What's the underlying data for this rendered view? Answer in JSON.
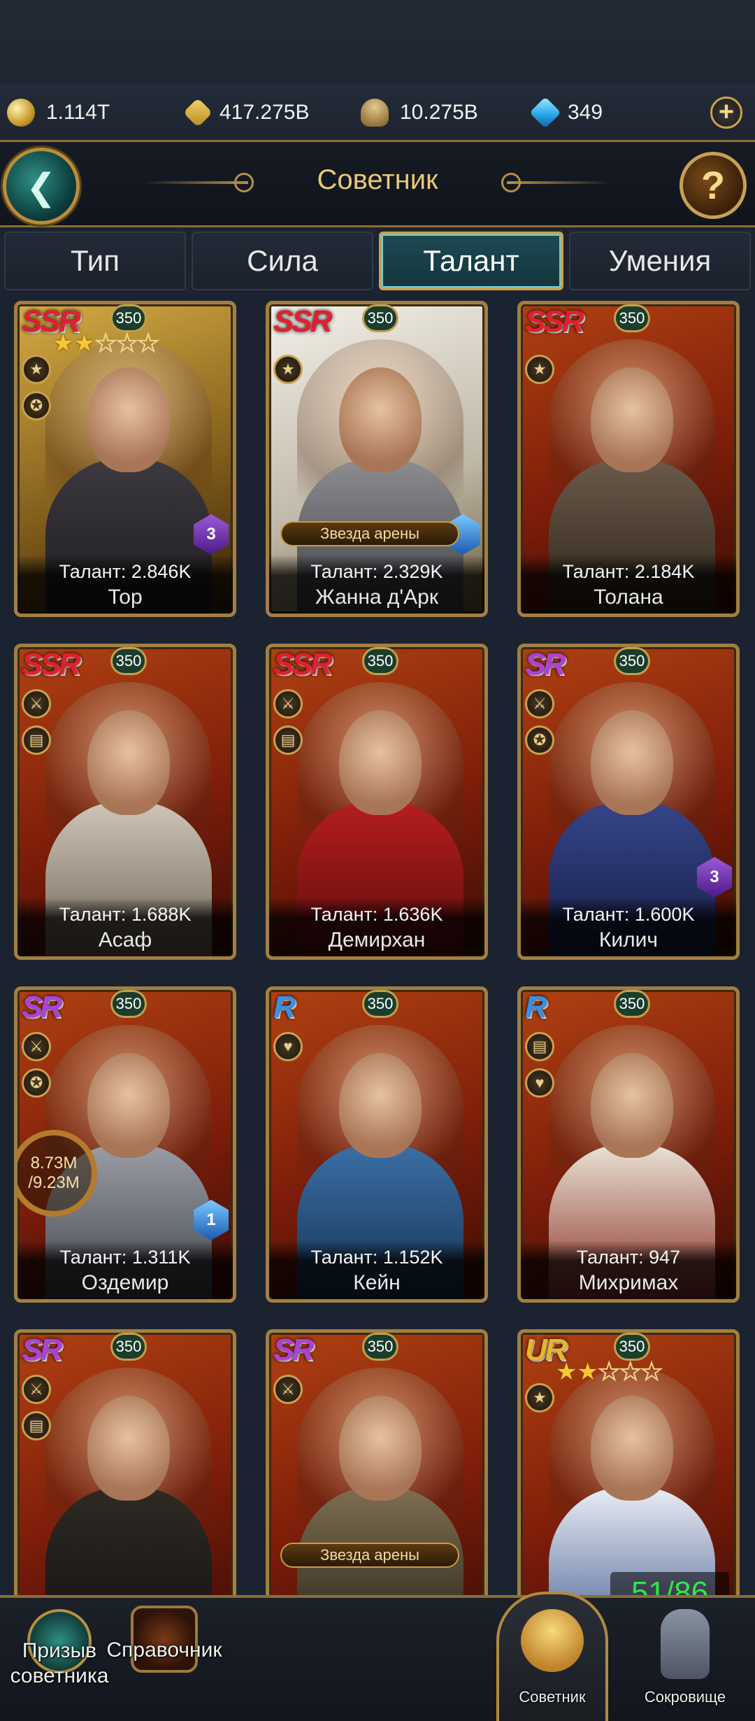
{
  "resources": [
    {
      "icon": "coin-icon",
      "value": "1.114T"
    },
    {
      "icon": "wheat-icon",
      "value": "417.275B"
    },
    {
      "icon": "helmet-icon",
      "value": "10.275B"
    },
    {
      "icon": "gem-icon",
      "value": "349"
    }
  ],
  "header": {
    "title": "Советник"
  },
  "tabs": [
    {
      "label": "Тип",
      "active": false
    },
    {
      "label": "Сила",
      "active": false
    },
    {
      "label": "Талант",
      "active": true
    },
    {
      "label": "Умения",
      "active": false
    }
  ],
  "cards": [
    {
      "rarity": "SSR",
      "level": "350",
      "talent": "Талант: 2.846K",
      "name": "Тор",
      "stars": 2,
      "star_total": 5,
      "badge": "3",
      "arena": ""
    },
    {
      "rarity": "SSR",
      "level": "350",
      "talent": "Талант: 2.329K",
      "name": "Жанна д'Арк",
      "stars": 0,
      "star_total": 0,
      "badge": "",
      "arena": "Звезда арены"
    },
    {
      "rarity": "SSR",
      "level": "350",
      "talent": "Талант: 2.184K",
      "name": "Толана",
      "stars": 0,
      "star_total": 0,
      "badge": "",
      "arena": ""
    },
    {
      "rarity": "SSR",
      "level": "350",
      "talent": "Талант: 1.688K",
      "name": "Асаф",
      "stars": 0,
      "star_total": 0,
      "badge": "",
      "arena": ""
    },
    {
      "rarity": "SSR",
      "level": "350",
      "talent": "Талант: 1.636K",
      "name": "Демирхан",
      "stars": 0,
      "star_total": 0,
      "badge": "",
      "arena": ""
    },
    {
      "rarity": "SR",
      "level": "350",
      "talent": "Талант: 1.600K",
      "name": "Килич",
      "stars": 0,
      "star_total": 0,
      "badge": "3",
      "arena": ""
    },
    {
      "rarity": "SR",
      "level": "350",
      "talent": "Талант: 1.311K",
      "name": "Оздемир",
      "stars": 0,
      "star_total": 0,
      "badge": "1",
      "arena": "",
      "progress_value": "8.73M",
      "progress_total": "/9.23M"
    },
    {
      "rarity": "R",
      "level": "350",
      "talent": "Талант: 1.152K",
      "name": "Кейн",
      "stars": 0,
      "star_total": 0,
      "badge": "",
      "arena": ""
    },
    {
      "rarity": "R",
      "level": "350",
      "talent": "Талант: 947",
      "name": "Михримах",
      "stars": 0,
      "star_total": 0,
      "badge": "",
      "arena": ""
    },
    {
      "rarity": "SR",
      "level": "350",
      "talent": "",
      "name": "",
      "stars": 0,
      "star_total": 0,
      "badge": "",
      "arena": ""
    },
    {
      "rarity": "SR",
      "level": "350",
      "talent": "",
      "name": "",
      "stars": 0,
      "star_total": 0,
      "badge": "",
      "arena": "Звезда арены"
    },
    {
      "rarity": "UR",
      "level": "350",
      "talent": "",
      "name": "",
      "stars": 2,
      "star_total": 5,
      "badge": "",
      "arena": "",
      "fragments": "51/86"
    }
  ],
  "bottom_nav": [
    {
      "label": "Призыв советника",
      "icon": "summon-icon"
    },
    {
      "label": "Справочник",
      "icon": "book-icon"
    },
    {
      "label": "Советник",
      "icon": "advisor-icon",
      "active": true
    },
    {
      "label": "Сокровище",
      "icon": "vase-icon"
    }
  ]
}
